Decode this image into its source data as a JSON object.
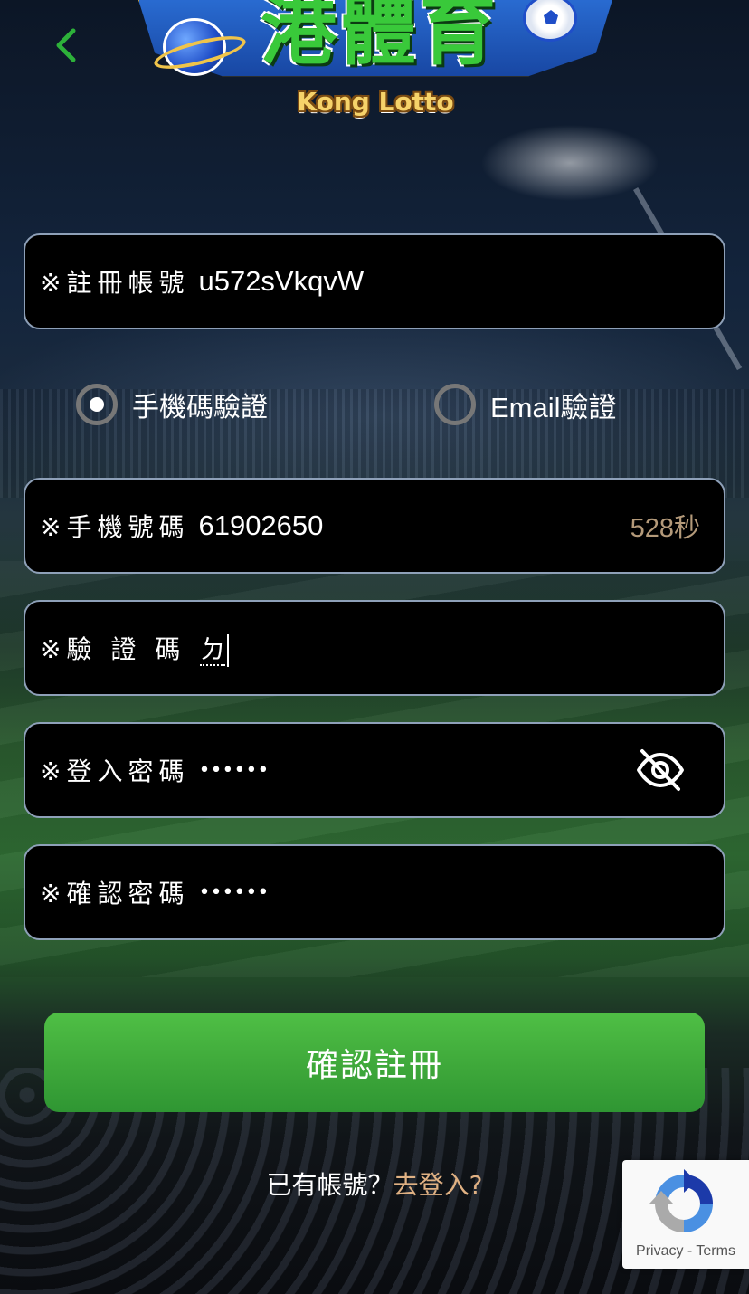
{
  "logo": {
    "title": "港體育",
    "subtitle": "Kong Lotto"
  },
  "form": {
    "account": {
      "label": "※註冊帳號",
      "value": "u572sVkqvW"
    },
    "verify_options": [
      {
        "label": "手機碼驗證",
        "selected": true
      },
      {
        "label": "Email驗證",
        "selected": false
      }
    ],
    "phone": {
      "label": "※手機號碼",
      "value": "61902650",
      "countdown": "528秒"
    },
    "code": {
      "label": "※驗 證 碼",
      "value": "ㄉ"
    },
    "password": {
      "label": "※登入密碼",
      "value": "••••••",
      "toggle_icon": "eye-off-icon"
    },
    "confirm_password": {
      "label": "※確認密碼",
      "value": "••••••"
    },
    "submit_label": "確認註冊"
  },
  "footer": {
    "prompt": "已有帳號？",
    "login_link": "去登入?"
  },
  "recaptcha": {
    "privacy": "Privacy",
    "separator": " - ",
    "terms": "Terms"
  },
  "colors": {
    "accent_green": "#3ea83a",
    "link_tan": "#e0b183",
    "countdown_tan": "#b49a7a",
    "field_border": "#8ea0b8"
  }
}
